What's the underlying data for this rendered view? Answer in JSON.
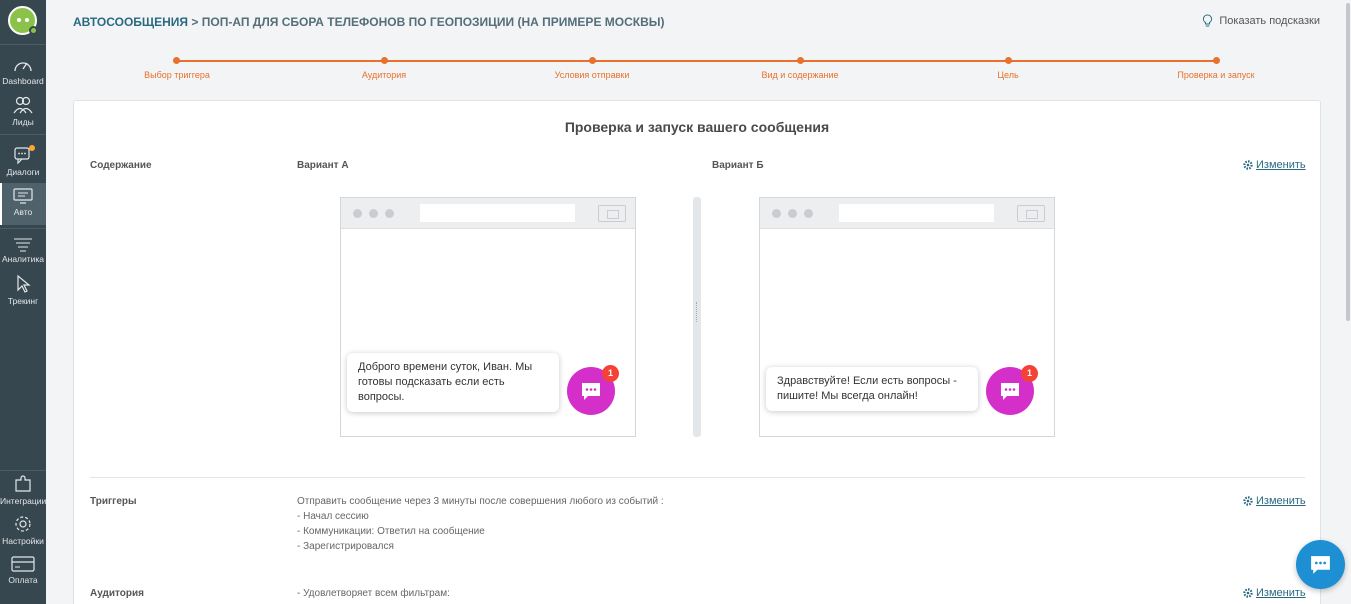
{
  "sidebar": {
    "items": [
      {
        "label": "Dashboard",
        "icon": "gauge-icon"
      },
      {
        "label": "Лиды",
        "icon": "users-icon"
      },
      {
        "label": "Диалоги",
        "icon": "chat-icon"
      },
      {
        "label": "Авто",
        "icon": "monitor-icon"
      },
      {
        "label": "Аналитика",
        "icon": "analytics-icon"
      },
      {
        "label": "Трекинг",
        "icon": "cursor-icon"
      },
      {
        "label": "Интеграции",
        "icon": "puzzle-icon"
      },
      {
        "label": "Настройки",
        "icon": "gear-icon"
      },
      {
        "label": "Оплата",
        "icon": "card-icon"
      }
    ],
    "active": "Авто"
  },
  "header": {
    "breadcrumb_root": "АВТОСООБЩЕНИЯ",
    "breadcrumb_sep": " > ",
    "breadcrumb_current": "ПОП-АП ДЛЯ СБОРА ТЕЛЕФОНОВ ПО ГЕОПОЗИЦИИ (НА ПРИМЕРЕ МОСКВЫ)",
    "hints_label": "Показать подсказки"
  },
  "stepper": {
    "steps": [
      "Выбор триггера",
      "Аудитория",
      "Условия отправки",
      "Вид и содержание",
      "Цель",
      "Проверка и запуск"
    ],
    "color": "#e8712b"
  },
  "review": {
    "title": "Проверка и запуск вашего сообщения",
    "content_label": "Содержание",
    "variant_a_label": "Вариант А",
    "variant_b_label": "Вариант Б",
    "variant_a_message": "Доброго времени суток, Иван. Мы готовы подсказать если есть вопросы.",
    "variant_b_message": "Здравствуйте! Если есть вопросы - пишите! Мы всегда онлайн!",
    "badge_count": "1",
    "change_label": "Изменить",
    "triggers_label": "Триггеры",
    "triggers_text": [
      "Отправить сообщение через 3 минуты после совершения любого из событий :",
      "- Начал сессию",
      "- Коммуникации: Ответил на сообщение",
      "- Зарегистрировался"
    ],
    "audience_label": "Аудитория",
    "audience_text": "- Удовлетворяет всем фильтрам:"
  },
  "colors": {
    "sidebar_bg": "#37474f",
    "accent_orange": "#e8712b",
    "chat_button": "#d42fc9",
    "link": "#2a6a80",
    "float_chat": "#1e8fd2"
  }
}
